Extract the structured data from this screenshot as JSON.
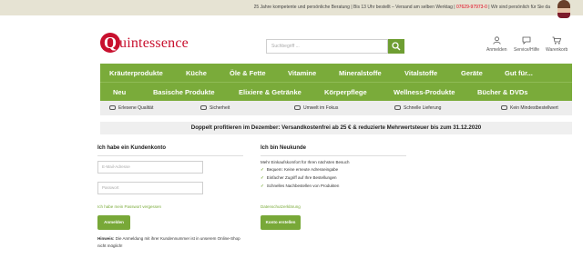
{
  "topbar": {
    "text": "25 Jahre kompetente und persönliche Beratung | Bis 13 Uhr bestellt – Versand am selben Werktag |",
    "phone": "07629-97973-0",
    "tail": "| Wir sind persönlich für Sie da"
  },
  "logo": {
    "q": "Q",
    "word": "uintessence"
  },
  "search": {
    "placeholder": "Suchbegriff ..."
  },
  "header_actions": {
    "login": "Anmelden",
    "service": "Service/Hilfe",
    "cart": "Warenkorb"
  },
  "nav": {
    "row1": [
      "Kräuterprodukte",
      "Küche",
      "Öle & Fette",
      "Vitamine",
      "Mineralstoffe",
      "Vitalstoffe",
      "Geräte",
      "Gut für..."
    ],
    "row2": [
      "Neu",
      "Basische Produkte",
      "Elixiere & Getränke",
      "Körperpflege",
      "Wellness-Produkte",
      "Bücher & DVDs"
    ]
  },
  "features": [
    "Erlesene Qualität",
    "Sicherheit",
    "Umwelt im Fokus",
    "Schnelle Lieferung",
    "Kein Mindestbestellwert"
  ],
  "promo": "Doppelt profitieren im Dezember: Versandkostenfrei ab 25 € & reduzierte Mehrwertsteuer bis zum 31.12.2020",
  "login": {
    "title": "Ich habe ein Kundenkonto",
    "email_placeholder": "E-Mail-Adresse",
    "password_placeholder": "Passwort",
    "forgot": "Ich habe mein Passwort vergessen",
    "submit": "Anmelden",
    "hint_label": "Hinweis:",
    "hint_text": "Die Anmeldung mit ihrer Kundennummer ist in unserem Online-Shop nicht möglich!"
  },
  "register": {
    "title": "Ich bin Neukunde",
    "intro": "Mehr Einkaufskomfort für Ihren nächsten Besuch",
    "benefits": [
      "Bequem: Keine erneute Adresseingabe",
      "Einfacher Zugriff auf Ihre Bestellungen",
      "Schnelles Nachbestellen von Produkten"
    ],
    "privacy": "Datenschutzerklärung",
    "submit": "Konto erstellen"
  },
  "colors": {
    "brand_red": "#c8102e",
    "nav_green": "#7aab3a",
    "button_green": "#78a838"
  }
}
